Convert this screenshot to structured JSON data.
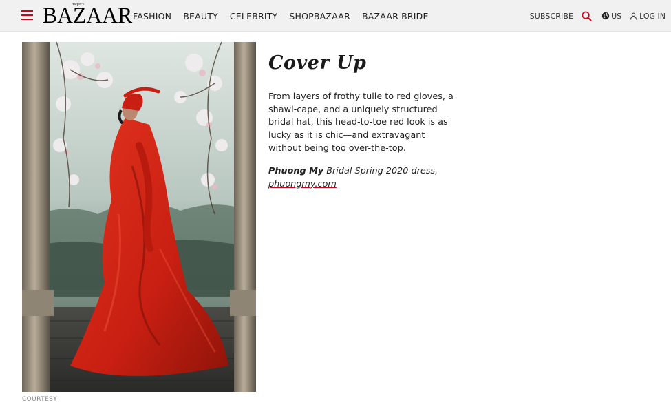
{
  "header": {
    "logo": "BAZAAR",
    "logo_tag": "Harper's",
    "nav": [
      "FASHION",
      "BEAUTY",
      "CELEBRITY",
      "SHOPBAZAAR",
      "BAZAAR BRIDE"
    ],
    "subscribe": "SUBSCRIBE",
    "region": "US",
    "login": "LOG IN",
    "icons": {
      "menu": "hamburger-icon",
      "search": "search-icon",
      "region": "globe-icon",
      "login": "user-icon"
    },
    "accent_color": "#d0011b"
  },
  "article": {
    "title": "Cover Up",
    "body": "From layers of frothy tulle to red gloves, a shawl-cape, and a uniquely structured bridal hat, this head-to-toe red look is as lucky as it is chic—and extravagant without being too over-the-top.",
    "credit_brand": "Phuong My",
    "credit_rest": " Bridal Spring 2020 dress,",
    "credit_link": "phuongmy.com",
    "image_caption": "COURTESY"
  }
}
